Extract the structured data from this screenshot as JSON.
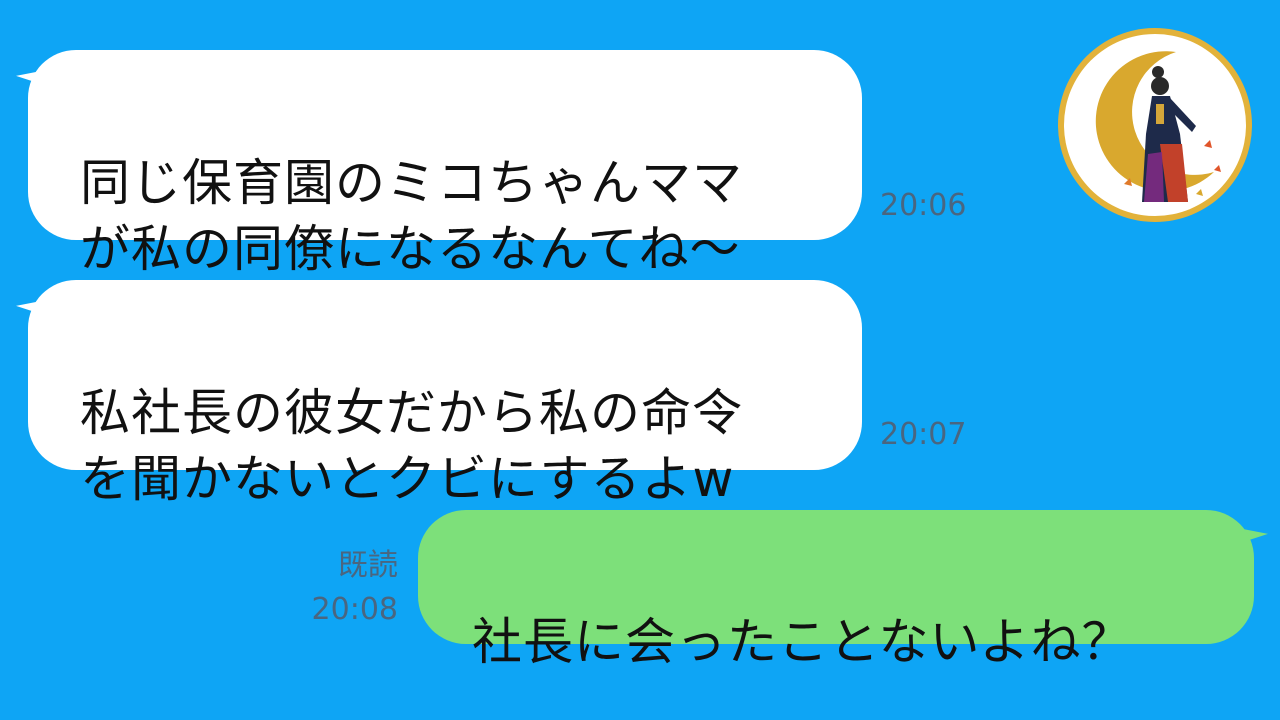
{
  "chat": {
    "messages": [
      {
        "direction": "incoming",
        "text": "同じ保育園のミコちゃんママ\nが私の同僚になるなんてね〜",
        "time": "20:06"
      },
      {
        "direction": "incoming",
        "text": "私社長の彼女だから私の命令\nを聞かないとクビにするよw",
        "time": "20:07"
      },
      {
        "direction": "outgoing",
        "text": "社長に会ったことないよね？",
        "read_label": "既読",
        "time": "20:08"
      }
    ]
  },
  "colors": {
    "background": "#0ea5f5",
    "incoming_bubble": "#ffffff",
    "outgoing_bubble": "#7de07a",
    "timestamp": "#4a6680",
    "avatar_ring": "#e2b23a"
  },
  "avatar": {
    "icon": "kimono-woman-crescent-moon-avatar"
  }
}
